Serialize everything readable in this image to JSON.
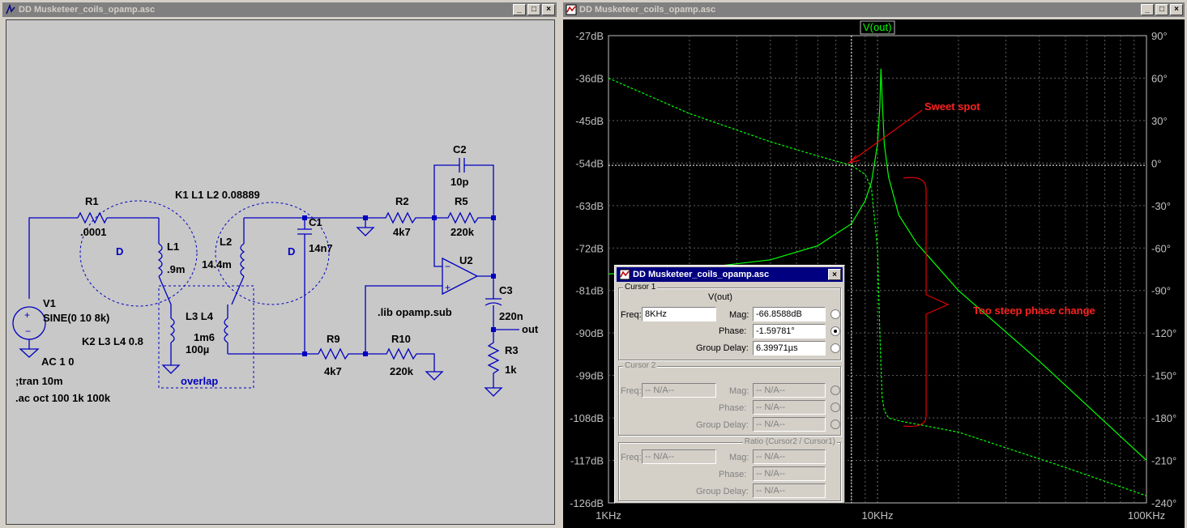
{
  "left_window": {
    "title": "DD Musketeer_coils_opamp.asc",
    "buttons": {
      "minimize": "_",
      "maximize": "□",
      "close": "×"
    },
    "schematic": {
      "components": {
        "r1": "R1",
        "r1_val": ".0001",
        "l1": "L1",
        "l1_val": ".9m",
        "l2": "L2",
        "l2_val": "14.4m",
        "c1": "C1",
        "c1_val": "14n7",
        "l3l4": "L3 L4",
        "l3l4_val": "1m6",
        "l3_val": "100µ",
        "v1": "V1",
        "v1_val": "SINE(0 10 8k)",
        "v1_ac": "AC 1 0",
        "r2": "R2",
        "r2_val": "4k7",
        "r5": "R5",
        "r5_val": "220k",
        "c2": "C2",
        "c2_val": "10p",
        "u2": "U2",
        "c3": "C3",
        "c3_val": "220n",
        "r3": "R3",
        "r3_val": "1k",
        "r9": "R9",
        "r9_val": "4k7",
        "r10": "R10",
        "r10_val": "220k",
        "out": "out"
      },
      "directives": {
        "k1": "K1 L1 L2 0.08889",
        "k2": "K2 L3 L4 0.8",
        "tran": ";tran 10m",
        "ac": ".ac oct 100 1k 100k",
        "lib": ".lib opamp.sub"
      },
      "labels": {
        "d_left": "D",
        "d_right": "D",
        "overlap": "overlap"
      }
    }
  },
  "right_window": {
    "title": "DD Musketeer_coils_opamp.asc",
    "buttons": {
      "minimize": "_",
      "maximize": "□",
      "close": "×"
    },
    "annotations": {
      "sweet_spot": "Sweet spot",
      "steep": "Too steep phase change"
    }
  },
  "chart_data": {
    "type": "line",
    "title": "",
    "trace_label": "V(out)",
    "x_scale": "log",
    "xlim": [
      1000,
      100000
    ],
    "x_tick_labels": [
      "1KHz",
      "10KHz",
      "100KHz"
    ],
    "y_left_lim_db": [
      -126,
      -27
    ],
    "y_left_tick_labels": [
      "-27dB",
      "-36dB",
      "-45dB",
      "-54dB",
      "-63dB",
      "-72dB",
      "-81dB",
      "-90dB",
      "-99dB",
      "-108dB",
      "-117dB",
      "-126dB"
    ],
    "y_right_lim_deg": [
      -240,
      90
    ],
    "y_right_tick_labels": [
      "90°",
      "60°",
      "30°",
      "0°",
      "-30°",
      "-60°",
      "-90°",
      "-120°",
      "-150°",
      "-180°",
      "-210°",
      "-240°"
    ],
    "grid": true,
    "cursor_freq_hz": 8000,
    "series": [
      {
        "name": "",
        "kind": "magnitude_db",
        "color": "#00ff00",
        "x": [
          1000,
          2000,
          4000,
          6000,
          7000,
          8000,
          9000,
          9500,
          10000,
          10200,
          10300,
          10400,
          10600,
          11000,
          12000,
          14000,
          20000,
          40000,
          100000
        ],
        "y": [
          -77.5,
          -76.5,
          -74.5,
          -71.5,
          -69,
          -66.9,
          -62,
          -58,
          -50,
          -42,
          -34,
          -40,
          -50,
          -57,
          -65,
          -71,
          -81,
          -96,
          -117
        ]
      },
      {
        "name": "",
        "kind": "phase_deg",
        "color": "#00ff00",
        "dashed": true,
        "x": [
          1000,
          2000,
          4000,
          6000,
          8000,
          9000,
          9500,
          10000,
          10200,
          10400,
          10600,
          11000,
          12000,
          20000,
          50000,
          100000
        ],
        "y": [
          60,
          35,
          15,
          5,
          -1.6,
          -8,
          -18,
          -60,
          -120,
          -165,
          -175,
          -180,
          -182,
          -190,
          -215,
          -235
        ]
      }
    ]
  },
  "cursor_dialog": {
    "title": "DD Musketeer_coils_opamp.asc",
    "close": "×",
    "cursor1": {
      "group": "Cursor 1",
      "trace": "V(out)",
      "freq_label": "Freq:",
      "freq": "8KHz",
      "mag_label": "Mag:",
      "mag": "-66.8588dB",
      "phase_label": "Phase:",
      "phase": "-1.59781°",
      "gd_label": "Group Delay:",
      "gd": "6.39971µs"
    },
    "cursor2": {
      "group": "Cursor 2",
      "freq_label": "Freq:",
      "freq": "-- N/A--",
      "mag_label": "Mag:",
      "mag": "-- N/A--",
      "phase_label": "Phase:",
      "phase": "-- N/A--",
      "gd_label": "Group Delay:",
      "gd": "-- N/A--"
    },
    "ratio": {
      "group": "Ratio (Cursor2 / Cursor1)",
      "freq_label": "Freq:",
      "freq": "-- N/A--",
      "mag_label": "Mag:",
      "mag": "-- N/A--",
      "phase_label": "Phase:",
      "phase": "-- N/A--",
      "gd_label": "Group Delay:",
      "gd": "-- N/A--"
    }
  }
}
